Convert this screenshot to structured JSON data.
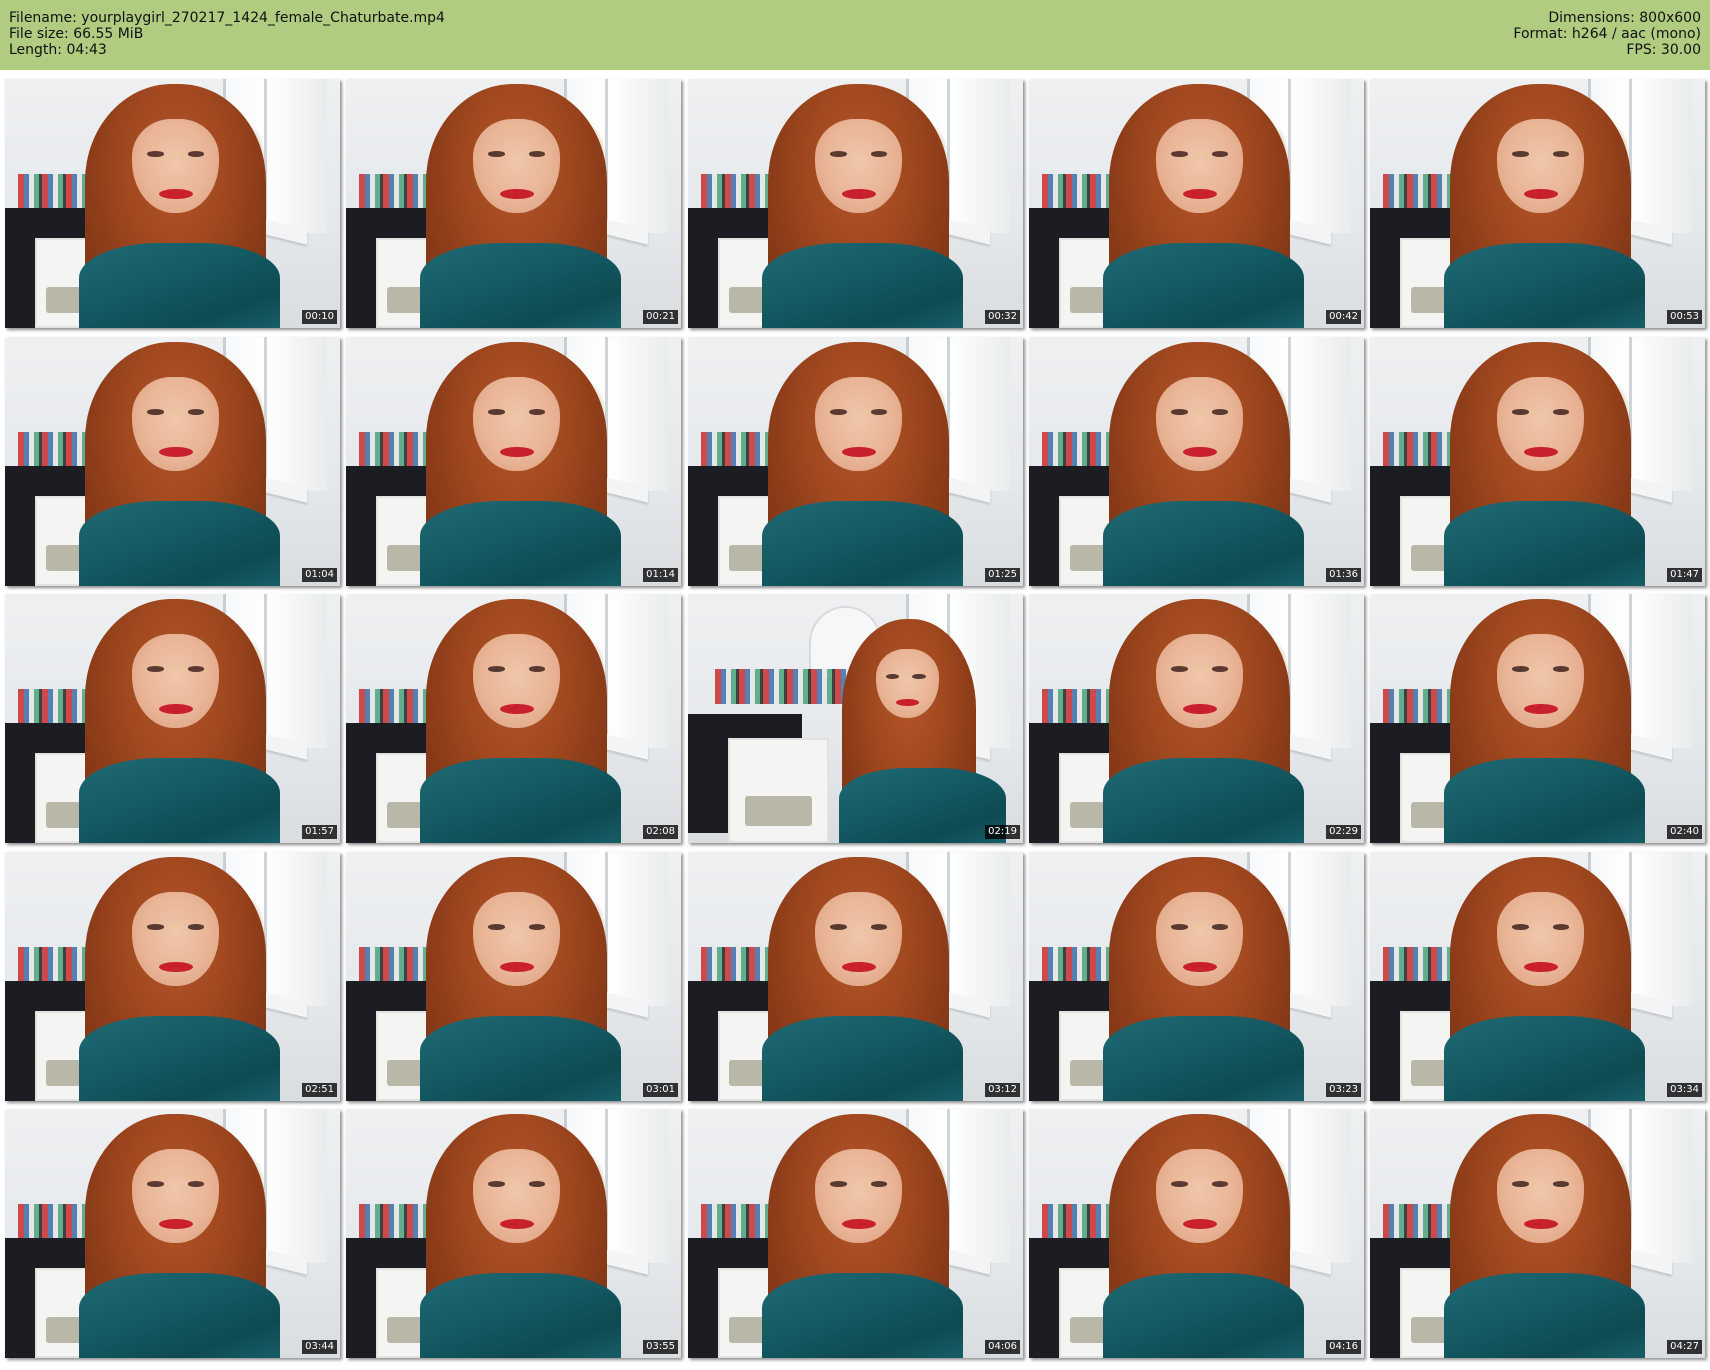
{
  "header": {
    "filename_line": "Filename: yourplaygirl_270217_1424_female_Chaturbate.mp4",
    "filesize_line": "File size: 66.55 MiB",
    "length_line": "Length: 04:43",
    "dimensions_line": "Dimensions: 800x600",
    "format_line": "Format: h264 / aac (mono)",
    "fps_line": "FPS: 30.00"
  },
  "colors": {
    "header_background": "#b0cc80",
    "timestamp_background": "#000000",
    "timestamp_text": "#ffffff"
  },
  "thumbnails": [
    {
      "timestamp": "00:10"
    },
    {
      "timestamp": "00:21"
    },
    {
      "timestamp": "00:32"
    },
    {
      "timestamp": "00:42"
    },
    {
      "timestamp": "00:53"
    },
    {
      "timestamp": "01:04"
    },
    {
      "timestamp": "01:14"
    },
    {
      "timestamp": "01:25"
    },
    {
      "timestamp": "01:36"
    },
    {
      "timestamp": "01:47"
    },
    {
      "timestamp": "01:57"
    },
    {
      "timestamp": "02:08"
    },
    {
      "timestamp": "02:19"
    },
    {
      "timestamp": "02:29"
    },
    {
      "timestamp": "02:40"
    },
    {
      "timestamp": "02:51"
    },
    {
      "timestamp": "03:01"
    },
    {
      "timestamp": "03:12"
    },
    {
      "timestamp": "03:23"
    },
    {
      "timestamp": "03:34"
    },
    {
      "timestamp": "03:44"
    },
    {
      "timestamp": "03:55"
    },
    {
      "timestamp": "04:06"
    },
    {
      "timestamp": "04:16"
    },
    {
      "timestamp": "04:27"
    }
  ]
}
